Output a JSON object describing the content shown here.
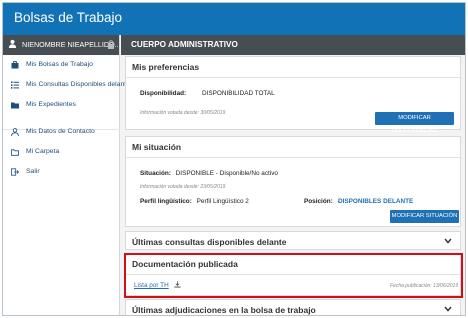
{
  "app": {
    "title": "Bolsas de Trabajo"
  },
  "user": {
    "name": "NIENOMBRE NIEAPELLIDO..."
  },
  "sidebar": {
    "items": [
      {
        "label": "Mis Bolsas de Trabajo",
        "icon": "briefcase-icon"
      },
      {
        "label": "Mis Consultas Disponibles delante",
        "icon": "list-icon"
      },
      {
        "label": "Mis Expedientes",
        "icon": "folder-icon"
      },
      {
        "label": "Mis Datos de Contacto",
        "icon": "person-icon"
      },
      {
        "label": "Mi Carpeta",
        "icon": "folder-outline-icon"
      },
      {
        "label": "Salir",
        "icon": "logout-icon"
      }
    ]
  },
  "main": {
    "header": "CUERPO ADMINISTRATIVO",
    "preferencias": {
      "title": "Mis preferencias",
      "disponibilidad_label": "Disponibilidad:",
      "disponibilidad_value": "DISPONIBILIDAD TOTAL",
      "info": "Información votada desde: 30/05/2019",
      "button": "MODIFICAR PREFERENCIAS"
    },
    "situacion": {
      "title": "Mi situación",
      "situacion_label": "Situación:",
      "situacion_value": "DISPONIBLE - Disponible/No activo",
      "info": "Información votada desde: 23/05/2019",
      "perfil_label": "Perfil lingüístico:",
      "perfil_value": "Perfil Lingüístico 2",
      "posicion_label": "Posición:",
      "posicion_value": "-",
      "disponibles": "DISPONIBLES DELANTE",
      "button": "MODIFICAR SITUACIÓN"
    },
    "consultas": {
      "title": "Últimas consultas disponibles delante"
    },
    "documentacion": {
      "title": "Documentación publicada",
      "link": "Lista por TH",
      "date": "Fecha publicación: 13/06/2019"
    },
    "adjudicaciones": {
      "title": "Últimas adjudicaciones en la bolsa de trabajo"
    }
  },
  "colors": {
    "topbar": "#1172b6",
    "dark": "#474e53",
    "button": "#1f70b5",
    "highlight": "#d20f16"
  }
}
